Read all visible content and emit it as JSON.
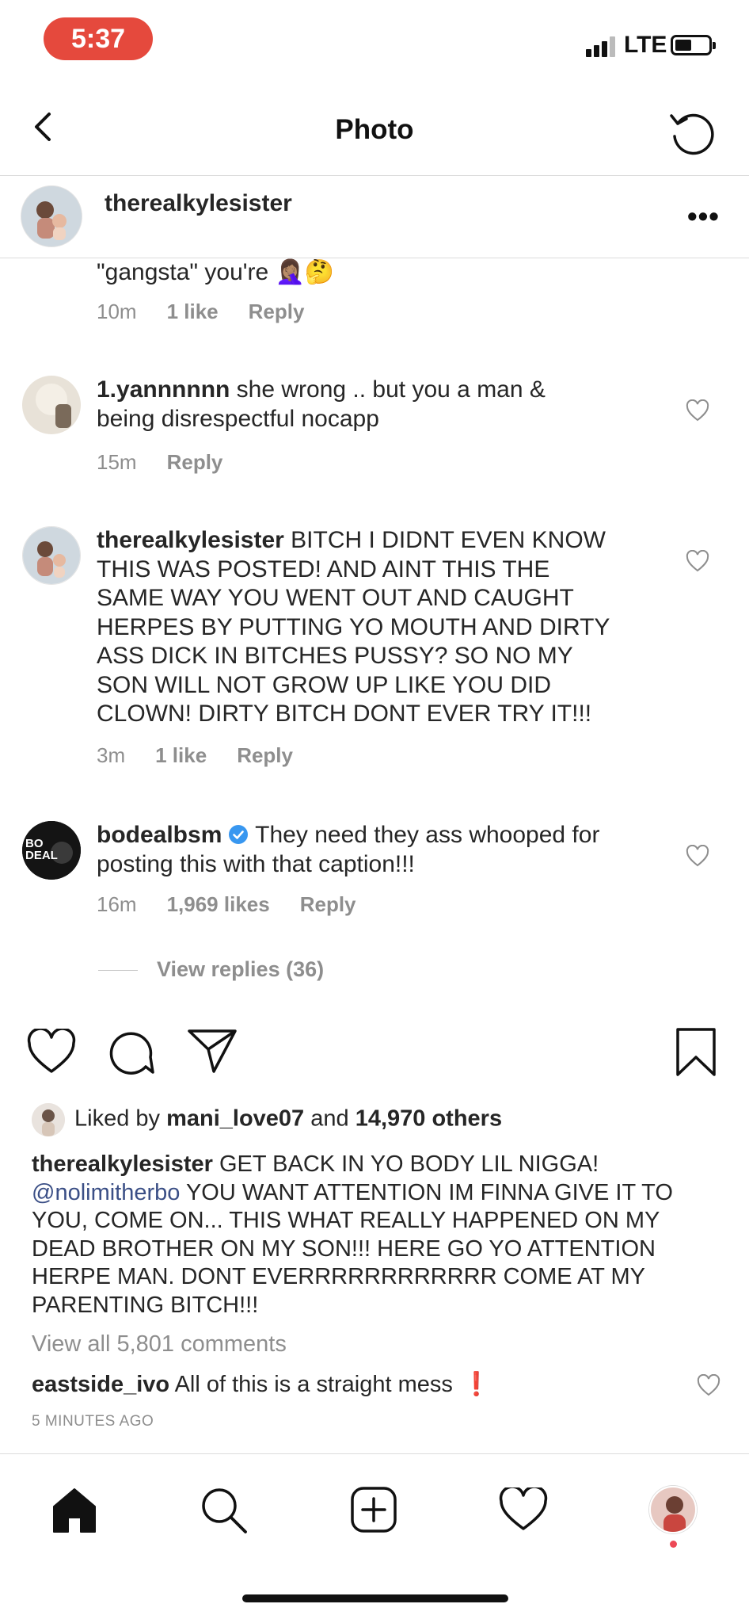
{
  "status_bar": {
    "time": "5:37",
    "network": "LTE"
  },
  "header": {
    "title": "Photo"
  },
  "post_owner": {
    "username": "therealkylesister"
  },
  "partial_comment": {
    "text": "\"gangsta\" you're 🤦🏽‍♀️🤔",
    "time": "10m",
    "likes": "1 like",
    "reply": "Reply"
  },
  "comments": [
    {
      "username": "1.yannnnnn",
      "line1": " she wrong .. but you a man &",
      "line2": "being disrespectful nocapp",
      "time": "15m",
      "reply": "Reply"
    },
    {
      "username": "therealkylesister",
      "line1": " BITCH I DIDNT EVEN KNOW",
      "line2": "THIS WAS POSTED! AND AINT THIS THE",
      "line3": "SAME WAY YOU WENT OUT AND CAUGHT",
      "line4": "HERPES BY PUTTING YO MOUTH AND DIRTY",
      "line5": "ASS DICK IN BITCHES PUSSY? SO NO MY",
      "line6": "SON WILL NOT GROW UP LIKE YOU DID",
      "line7": "CLOWN! DIRTY BITCH DONT EVER TRY IT!!!",
      "time": "3m",
      "likes": "1 like",
      "reply": "Reply"
    },
    {
      "username": "bodealbsm",
      "line1": " They need they ass whooped for",
      "line2": "posting this with that caption!!!",
      "time": "16m",
      "likes": "1,969 likes",
      "reply": "Reply",
      "avatar_text_top": "BO",
      "avatar_text_bottom": "DEAL"
    }
  ],
  "view_replies": "View replies (36)",
  "likes": {
    "prefix": "Liked by ",
    "user": "mani_love07",
    "middle": " and ",
    "others": "14,970 others"
  },
  "caption": {
    "username": "therealkylesister",
    "line1": " GET BACK IN YO BODY LIL NIGGA!",
    "mention": "@nolimitherbo",
    "line2": " YOU WANT ATTENTION IM FINNA GIVE IT TO",
    "line3": "YOU, COME ON... THIS WHAT REALLY HAPPENED ON MY",
    "line4": "DEAD BROTHER ON MY SON!!! HERE GO YO ATTENTION",
    "line5": "HERPE MAN. DONT EVERRRRRRRRRRRR COME AT MY",
    "line6": "PARENTING BITCH!!!"
  },
  "view_all_comments": "View all 5,801 comments",
  "latest_comment": {
    "username": "eastside_ivo",
    "text": " All of this is a straight mess",
    "emoji": "❗"
  },
  "time_ago": "5 MINUTES AGO",
  "icons": {
    "back": "chevron-left-icon",
    "refresh": "refresh-icon",
    "more": "more-dots-icon",
    "like": "heart-icon",
    "comment": "comment-bubble-icon",
    "share": "paper-plane-icon",
    "save": "bookmark-icon",
    "home": "home-icon",
    "search": "search-icon",
    "new_post": "add-post-icon",
    "activity": "heart-icon",
    "profile": "profile-avatar"
  },
  "colors": {
    "time_pill": "#e5493d",
    "mention": "#3b4f86",
    "notification_dot": "#ed4956",
    "muted_text": "#8e8e8e"
  }
}
